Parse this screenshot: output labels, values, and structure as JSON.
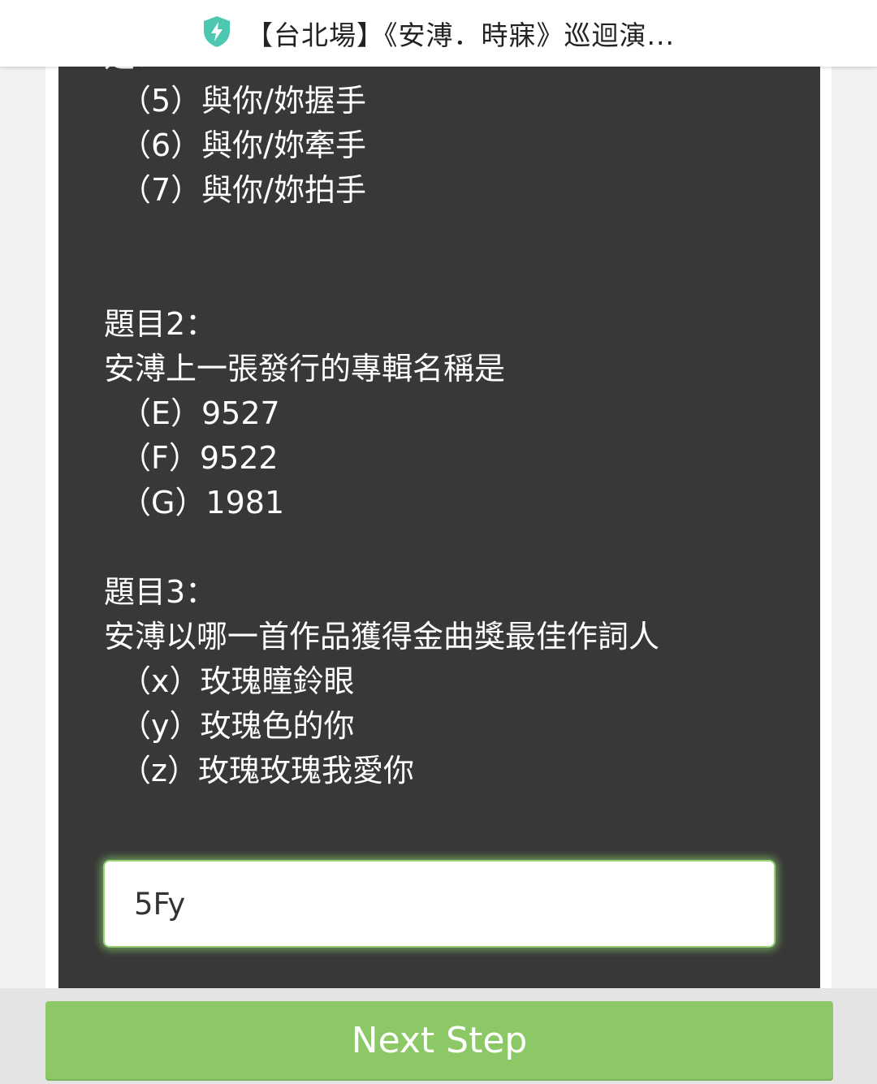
{
  "titlebar": {
    "icon": "shield-lightning-icon",
    "title": "【台北場】《安溥．時寐》巡迴演..."
  },
  "quiz": {
    "partial_text": "是：",
    "q1_options": [
      "（5）與你/妳握手",
      "（6）與你/妳牽手",
      "（7）與你/妳拍手"
    ],
    "q2": {
      "label": "題目2：",
      "question": "安溥上一張發行的專輯名稱是",
      "options": [
        "（E）9527",
        "（F）9522",
        "（G）1981"
      ]
    },
    "q3": {
      "label": "題目3：",
      "question": "安溥以哪一首作品獲得金曲獎最佳作詞人",
      "options": [
        "（x）玫瑰瞳鈴眼",
        "（y）玫瑰色的你",
        "（z）玫瑰玫瑰我愛你"
      ]
    }
  },
  "answer": {
    "value": "5Fy"
  },
  "footer": {
    "next_label": "Next Step"
  },
  "colors": {
    "panel": "#383838",
    "accent_green": "#8cc866",
    "titlebar_bg": "#ffffff",
    "shield_icon": "#4cc7b0"
  }
}
